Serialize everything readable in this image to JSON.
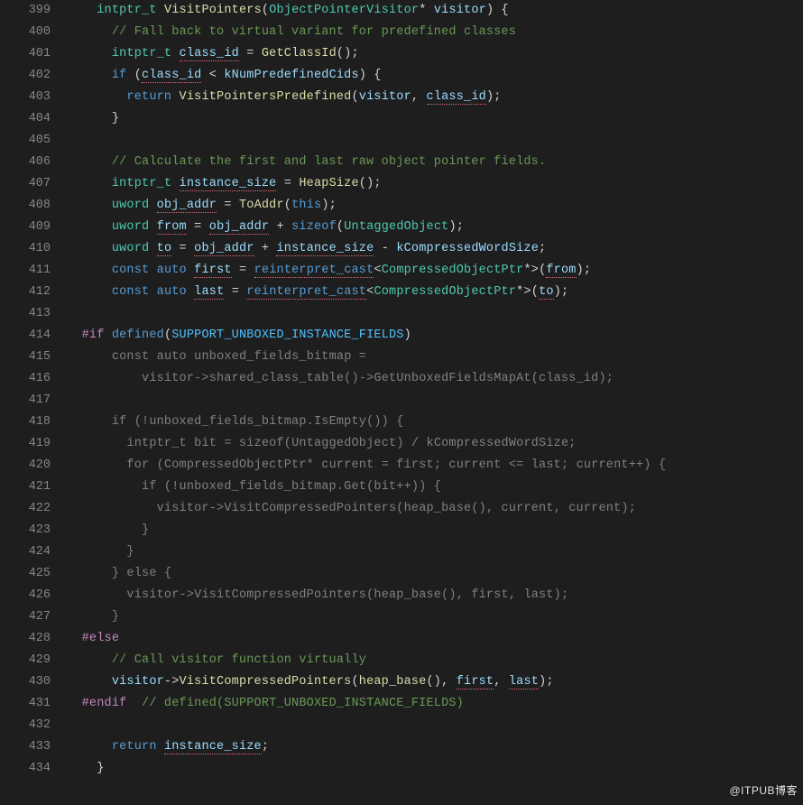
{
  "watermark": "@ITPUB博客",
  "gutter_start": 399,
  "lines": [
    [
      [
        "    "
      ],
      [
        "intptr_t",
        "type"
      ],
      [
        " "
      ],
      [
        "VisitPointers",
        "fn"
      ],
      [
        "("
      ],
      [
        "ObjectPointerVisitor",
        "type"
      ],
      [
        "*"
      ],
      [
        " "
      ],
      [
        "visitor",
        "var"
      ],
      [
        ") {"
      ]
    ],
    [
      [
        "      "
      ],
      [
        "// Fall back to virtual variant for predefined classes",
        "cmt"
      ]
    ],
    [
      [
        "      "
      ],
      [
        "intptr_t",
        "type"
      ],
      [
        " "
      ],
      [
        "class_id",
        "var squig-var"
      ],
      [
        " = "
      ],
      [
        "GetClassId",
        "fn"
      ],
      [
        "();"
      ]
    ],
    [
      [
        "      "
      ],
      [
        "if",
        "kw"
      ],
      [
        " ("
      ],
      [
        "class_id",
        "var squig-var"
      ],
      [
        " < "
      ],
      [
        "kNumPredefinedCids",
        "var"
      ],
      [
        ") {"
      ]
    ],
    [
      [
        "        "
      ],
      [
        "return",
        "kw"
      ],
      [
        " "
      ],
      [
        "VisitPointersPredefined",
        "fn"
      ],
      [
        "("
      ],
      [
        "visitor",
        "var"
      ],
      [
        ", "
      ],
      [
        "class_id",
        "var squig-var"
      ],
      [
        ");"
      ]
    ],
    [
      [
        "      "
      ],
      [
        "}"
      ]
    ],
    [
      [
        ""
      ]
    ],
    [
      [
        "      "
      ],
      [
        "// Calculate the first and last raw object pointer fields.",
        "cmt"
      ]
    ],
    [
      [
        "      "
      ],
      [
        "intptr_t",
        "type"
      ],
      [
        " "
      ],
      [
        "instance_size",
        "var squig-var"
      ],
      [
        " = "
      ],
      [
        "HeapSize",
        "fn"
      ],
      [
        "();"
      ]
    ],
    [
      [
        "      "
      ],
      [
        "uword",
        "type"
      ],
      [
        " "
      ],
      [
        "obj_addr",
        "var squig-var"
      ],
      [
        " = "
      ],
      [
        "ToAddr",
        "fn"
      ],
      [
        "("
      ],
      [
        "this",
        "this"
      ],
      [
        ");"
      ]
    ],
    [
      [
        "      "
      ],
      [
        "uword",
        "type"
      ],
      [
        " "
      ],
      [
        "from",
        "var squig-var"
      ],
      [
        " = "
      ],
      [
        "obj_addr",
        "var squig-var"
      ],
      [
        " + "
      ],
      [
        "sizeof",
        "kw"
      ],
      [
        "("
      ],
      [
        "UntaggedObject",
        "type"
      ],
      [
        ");"
      ]
    ],
    [
      [
        "      "
      ],
      [
        "uword",
        "type"
      ],
      [
        " "
      ],
      [
        "to",
        "var squig-var"
      ],
      [
        " = "
      ],
      [
        "obj_addr",
        "var squig-var"
      ],
      [
        " + "
      ],
      [
        "instance_size",
        "var squig-var"
      ],
      [
        " - "
      ],
      [
        "kCompressedWordSize",
        "var"
      ],
      [
        ";"
      ]
    ],
    [
      [
        "      "
      ],
      [
        "const",
        "kw"
      ],
      [
        " "
      ],
      [
        "auto",
        "kw"
      ],
      [
        " "
      ],
      [
        "first",
        "var squig-var"
      ],
      [
        " = "
      ],
      [
        "reinterpret_cast",
        "kw squig-fn"
      ],
      [
        "<"
      ],
      [
        "CompressedObjectPtr",
        "type"
      ],
      [
        "*>("
      ],
      [
        "from",
        "var squig-var"
      ],
      [
        ");"
      ]
    ],
    [
      [
        "      "
      ],
      [
        "const",
        "kw"
      ],
      [
        " "
      ],
      [
        "auto",
        "kw"
      ],
      [
        " "
      ],
      [
        "last",
        "var squig-var"
      ],
      [
        " = "
      ],
      [
        "reinterpret_cast",
        "kw squig-fn"
      ],
      [
        "<"
      ],
      [
        "CompressedObjectPtr",
        "type"
      ],
      [
        "*>("
      ],
      [
        "to",
        "var squig-var"
      ],
      [
        ");"
      ]
    ],
    [
      [
        ""
      ]
    ],
    [
      [
        "  "
      ],
      [
        "#if",
        "pp"
      ],
      [
        " "
      ],
      [
        "defined",
        "ppkw"
      ],
      [
        "("
      ],
      [
        "SUPPORT_UNBOXED_INSTANCE_FIELDS",
        "mac"
      ],
      [
        ")"
      ]
    ],
    [
      [
        "      "
      ],
      [
        "const",
        "kw dim"
      ],
      [
        " "
      ],
      [
        "auto",
        "kw dim"
      ],
      [
        " "
      ],
      [
        "unboxed_fields_bitmap",
        "var dim"
      ],
      [
        " = ",
        "dim"
      ]
    ],
    [
      [
        "          "
      ],
      [
        "visitor",
        "var dim"
      ],
      [
        "->",
        "dim"
      ],
      [
        "shared_class_table",
        "fn dim"
      ],
      [
        "()",
        "dim"
      ],
      [
        "->",
        "dim"
      ],
      [
        "GetUnboxedFieldsMapAt",
        "fn dim"
      ],
      [
        "(",
        "dim"
      ],
      [
        "class_id",
        "var dim"
      ],
      [
        ");",
        "dim"
      ]
    ],
    [
      [
        ""
      ]
    ],
    [
      [
        "      "
      ],
      [
        "if",
        "kw dim"
      ],
      [
        " (!",
        "dim"
      ],
      [
        "unboxed_fields_bitmap",
        "var dim"
      ],
      [
        ".",
        "dim"
      ],
      [
        "IsEmpty",
        "fn dim"
      ],
      [
        "()) {",
        "dim"
      ]
    ],
    [
      [
        "        "
      ],
      [
        "intptr_t",
        "type dim"
      ],
      [
        " ",
        "dim"
      ],
      [
        "bit",
        "var dim"
      ],
      [
        " = ",
        "dim"
      ],
      [
        "sizeof",
        "kw dim"
      ],
      [
        "(",
        "dim"
      ],
      [
        "UntaggedObject",
        "type dim"
      ],
      [
        ") / ",
        "dim"
      ],
      [
        "kCompressedWordSize",
        "var dim"
      ],
      [
        ";",
        "dim"
      ]
    ],
    [
      [
        "        "
      ],
      [
        "for",
        "kw dim"
      ],
      [
        " (",
        "dim"
      ],
      [
        "CompressedObjectPtr",
        "type dim"
      ],
      [
        "* ",
        "dim"
      ],
      [
        "current",
        "var dim"
      ],
      [
        " = ",
        "dim"
      ],
      [
        "first",
        "var dim"
      ],
      [
        "; ",
        "dim"
      ],
      [
        "current",
        "var dim"
      ],
      [
        " <= ",
        "dim"
      ],
      [
        "last",
        "var dim"
      ],
      [
        "; ",
        "dim"
      ],
      [
        "current",
        "var dim"
      ],
      [
        "++) {",
        "dim"
      ]
    ],
    [
      [
        "          "
      ],
      [
        "if",
        "kw dim"
      ],
      [
        " (!",
        "dim"
      ],
      [
        "unboxed_fields_bitmap",
        "var dim"
      ],
      [
        ".",
        "dim"
      ],
      [
        "Get",
        "fn dim"
      ],
      [
        "(",
        "dim"
      ],
      [
        "bit",
        "var dim"
      ],
      [
        "++)) {",
        "dim"
      ]
    ],
    [
      [
        "            "
      ],
      [
        "visitor",
        "var dim"
      ],
      [
        "->",
        "dim"
      ],
      [
        "VisitCompressedPointers",
        "fn dim"
      ],
      [
        "(",
        "dim"
      ],
      [
        "heap_base",
        "fn dim"
      ],
      [
        "(), ",
        "dim"
      ],
      [
        "current",
        "var dim"
      ],
      [
        ", ",
        "dim"
      ],
      [
        "current",
        "var dim"
      ],
      [
        ");",
        "dim"
      ]
    ],
    [
      [
        "          "
      ],
      [
        "}",
        "dim"
      ]
    ],
    [
      [
        "        "
      ],
      [
        "}",
        "dim"
      ]
    ],
    [
      [
        "      "
      ],
      [
        "} ",
        "dim"
      ],
      [
        "else",
        "kw dim"
      ],
      [
        " {",
        "dim"
      ]
    ],
    [
      [
        "        "
      ],
      [
        "visitor",
        "var dim"
      ],
      [
        "->",
        "dim"
      ],
      [
        "VisitCompressedPointers",
        "fn dim"
      ],
      [
        "(",
        "dim"
      ],
      [
        "heap_base",
        "fn dim"
      ],
      [
        "(), ",
        "dim"
      ],
      [
        "first",
        "var dim"
      ],
      [
        ", ",
        "dim"
      ],
      [
        "last",
        "var dim"
      ],
      [
        ");",
        "dim"
      ]
    ],
    [
      [
        "      "
      ],
      [
        "}",
        "dim"
      ]
    ],
    [
      [
        "  "
      ],
      [
        "#else",
        "pp"
      ]
    ],
    [
      [
        "      "
      ],
      [
        "// Call visitor function virtually",
        "cmt"
      ]
    ],
    [
      [
        "      "
      ],
      [
        "visitor",
        "var"
      ],
      [
        "->"
      ],
      [
        "VisitCompressedPointers",
        "fn"
      ],
      [
        "("
      ],
      [
        "heap_base",
        "fn"
      ],
      [
        "(), "
      ],
      [
        "first",
        "var squig-var"
      ],
      [
        ", "
      ],
      [
        "last",
        "var squig-var"
      ],
      [
        ");"
      ]
    ],
    [
      [
        "  "
      ],
      [
        "#endif",
        "pp"
      ],
      [
        "  "
      ],
      [
        "// defined(SUPPORT_UNBOXED_INSTANCE_FIELDS)",
        "cmt"
      ]
    ],
    [
      [
        ""
      ]
    ],
    [
      [
        "      "
      ],
      [
        "return",
        "kw"
      ],
      [
        " "
      ],
      [
        "instance_size",
        "var squig-var"
      ],
      [
        ";"
      ]
    ],
    [
      [
        "    "
      ],
      [
        "}"
      ]
    ]
  ]
}
